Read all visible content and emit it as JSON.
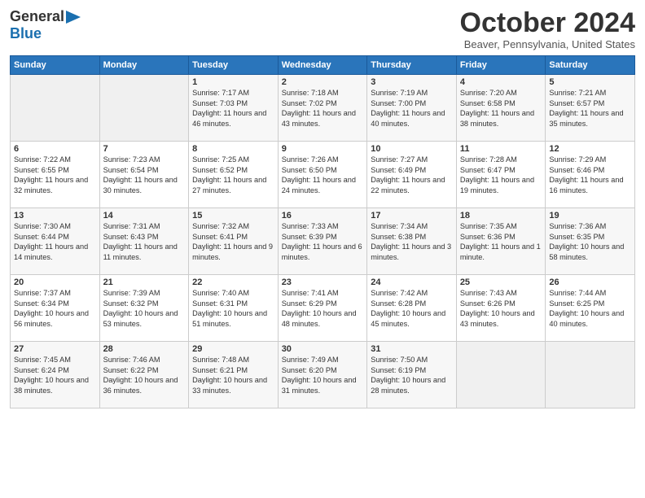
{
  "header": {
    "logo_line1": "General",
    "logo_line2": "Blue",
    "month": "October 2024",
    "location": "Beaver, Pennsylvania, United States"
  },
  "weekdays": [
    "Sunday",
    "Monday",
    "Tuesday",
    "Wednesday",
    "Thursday",
    "Friday",
    "Saturday"
  ],
  "weeks": [
    [
      {
        "day": "",
        "info": ""
      },
      {
        "day": "",
        "info": ""
      },
      {
        "day": "1",
        "info": "Sunrise: 7:17 AM\nSunset: 7:03 PM\nDaylight: 11 hours and 46 minutes."
      },
      {
        "day": "2",
        "info": "Sunrise: 7:18 AM\nSunset: 7:02 PM\nDaylight: 11 hours and 43 minutes."
      },
      {
        "day": "3",
        "info": "Sunrise: 7:19 AM\nSunset: 7:00 PM\nDaylight: 11 hours and 40 minutes."
      },
      {
        "day": "4",
        "info": "Sunrise: 7:20 AM\nSunset: 6:58 PM\nDaylight: 11 hours and 38 minutes."
      },
      {
        "day": "5",
        "info": "Sunrise: 7:21 AM\nSunset: 6:57 PM\nDaylight: 11 hours and 35 minutes."
      }
    ],
    [
      {
        "day": "6",
        "info": "Sunrise: 7:22 AM\nSunset: 6:55 PM\nDaylight: 11 hours and 32 minutes."
      },
      {
        "day": "7",
        "info": "Sunrise: 7:23 AM\nSunset: 6:54 PM\nDaylight: 11 hours and 30 minutes."
      },
      {
        "day": "8",
        "info": "Sunrise: 7:25 AM\nSunset: 6:52 PM\nDaylight: 11 hours and 27 minutes."
      },
      {
        "day": "9",
        "info": "Sunrise: 7:26 AM\nSunset: 6:50 PM\nDaylight: 11 hours and 24 minutes."
      },
      {
        "day": "10",
        "info": "Sunrise: 7:27 AM\nSunset: 6:49 PM\nDaylight: 11 hours and 22 minutes."
      },
      {
        "day": "11",
        "info": "Sunrise: 7:28 AM\nSunset: 6:47 PM\nDaylight: 11 hours and 19 minutes."
      },
      {
        "day": "12",
        "info": "Sunrise: 7:29 AM\nSunset: 6:46 PM\nDaylight: 11 hours and 16 minutes."
      }
    ],
    [
      {
        "day": "13",
        "info": "Sunrise: 7:30 AM\nSunset: 6:44 PM\nDaylight: 11 hours and 14 minutes."
      },
      {
        "day": "14",
        "info": "Sunrise: 7:31 AM\nSunset: 6:43 PM\nDaylight: 11 hours and 11 minutes."
      },
      {
        "day": "15",
        "info": "Sunrise: 7:32 AM\nSunset: 6:41 PM\nDaylight: 11 hours and 9 minutes."
      },
      {
        "day": "16",
        "info": "Sunrise: 7:33 AM\nSunset: 6:39 PM\nDaylight: 11 hours and 6 minutes."
      },
      {
        "day": "17",
        "info": "Sunrise: 7:34 AM\nSunset: 6:38 PM\nDaylight: 11 hours and 3 minutes."
      },
      {
        "day": "18",
        "info": "Sunrise: 7:35 AM\nSunset: 6:36 PM\nDaylight: 11 hours and 1 minute."
      },
      {
        "day": "19",
        "info": "Sunrise: 7:36 AM\nSunset: 6:35 PM\nDaylight: 10 hours and 58 minutes."
      }
    ],
    [
      {
        "day": "20",
        "info": "Sunrise: 7:37 AM\nSunset: 6:34 PM\nDaylight: 10 hours and 56 minutes."
      },
      {
        "day": "21",
        "info": "Sunrise: 7:39 AM\nSunset: 6:32 PM\nDaylight: 10 hours and 53 minutes."
      },
      {
        "day": "22",
        "info": "Sunrise: 7:40 AM\nSunset: 6:31 PM\nDaylight: 10 hours and 51 minutes."
      },
      {
        "day": "23",
        "info": "Sunrise: 7:41 AM\nSunset: 6:29 PM\nDaylight: 10 hours and 48 minutes."
      },
      {
        "day": "24",
        "info": "Sunrise: 7:42 AM\nSunset: 6:28 PM\nDaylight: 10 hours and 45 minutes."
      },
      {
        "day": "25",
        "info": "Sunrise: 7:43 AM\nSunset: 6:26 PM\nDaylight: 10 hours and 43 minutes."
      },
      {
        "day": "26",
        "info": "Sunrise: 7:44 AM\nSunset: 6:25 PM\nDaylight: 10 hours and 40 minutes."
      }
    ],
    [
      {
        "day": "27",
        "info": "Sunrise: 7:45 AM\nSunset: 6:24 PM\nDaylight: 10 hours and 38 minutes."
      },
      {
        "day": "28",
        "info": "Sunrise: 7:46 AM\nSunset: 6:22 PM\nDaylight: 10 hours and 36 minutes."
      },
      {
        "day": "29",
        "info": "Sunrise: 7:48 AM\nSunset: 6:21 PM\nDaylight: 10 hours and 33 minutes."
      },
      {
        "day": "30",
        "info": "Sunrise: 7:49 AM\nSunset: 6:20 PM\nDaylight: 10 hours and 31 minutes."
      },
      {
        "day": "31",
        "info": "Sunrise: 7:50 AM\nSunset: 6:19 PM\nDaylight: 10 hours and 28 minutes."
      },
      {
        "day": "",
        "info": ""
      },
      {
        "day": "",
        "info": ""
      }
    ]
  ]
}
